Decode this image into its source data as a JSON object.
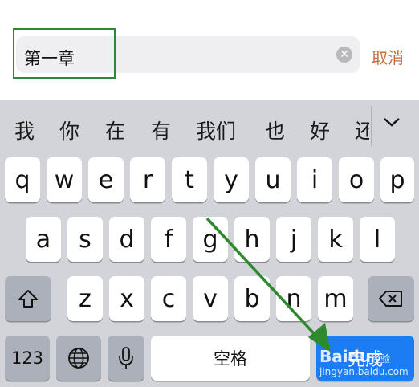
{
  "search": {
    "value": "第一章",
    "clear_icon": "clear-icon"
  },
  "cancel_label": "取消",
  "candidates": [
    "我",
    "你",
    "在",
    "有",
    "我们",
    "也",
    "好",
    "还"
  ],
  "expand_icon": "chevron-down-icon",
  "keyboard": {
    "row1": [
      "q",
      "w",
      "e",
      "r",
      "t",
      "y",
      "u",
      "i",
      "o",
      "p"
    ],
    "row2": [
      "a",
      "s",
      "d",
      "f",
      "g",
      "h",
      "j",
      "k",
      "l"
    ],
    "row3": [
      "z",
      "x",
      "c",
      "v",
      "b",
      "n",
      "m"
    ],
    "numbers_label": "123",
    "space_label": "空格",
    "done_label": "完成",
    "shift_icon": "shift-icon",
    "globe_icon": "globe-icon",
    "mic_icon": "microphone-icon",
    "backspace_icon": "backspace-icon"
  },
  "watermark": {
    "brand": "Bai",
    "paw": "du",
    "suffix": "经验",
    "url": "jingyan.baidu.com"
  },
  "colors": {
    "accent": "#c76c3a",
    "done_blue": "#1c7cf4",
    "annotation_green": "#2f8a2f"
  }
}
